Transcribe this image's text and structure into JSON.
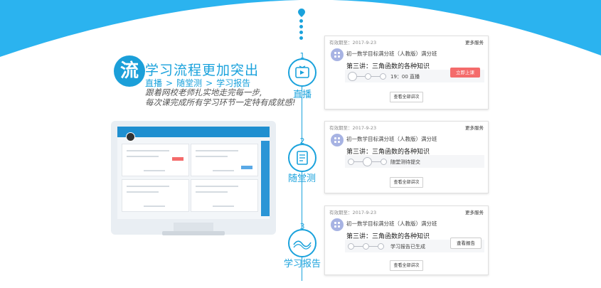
{
  "hero": {
    "badge": "流",
    "title": "学习流程更加突出",
    "steps": [
      "直播",
      "随堂测",
      "学习报告"
    ],
    "separator": ">",
    "line1": "跟着网校老师扎实地走完每一步,",
    "line2": "每次课完成所有学习环节一定特有成就感!"
  },
  "timeline": {
    "steps": [
      {
        "num": "1",
        "label": "直播",
        "icon": "tv-icon"
      },
      {
        "num": "2",
        "label": "随堂测",
        "icon": "quiz-sheet-icon"
      },
      {
        "num": "3",
        "label": "学习报告",
        "icon": "report-wave-icon"
      }
    ]
  },
  "cards": [
    {
      "validity": "有效期至：2017-9-23",
      "more": "更多服务",
      "class_name": "初一数学目标满分班（人教版）满分班",
      "lesson": "第三讲：三角函数的各种知识",
      "status": "19：00 直播",
      "action": "立即上课",
      "all": "查看全部讲次"
    },
    {
      "validity": "有效期至：2017-9-23",
      "more": "更多服务",
      "class_name": "初一数学目标满分班（人教版）满分班",
      "lesson": "第三讲：三角函数的各种知识",
      "status": "随堂测待提交",
      "all": "查看全部讲次"
    },
    {
      "validity": "有效期至：2017-9-23",
      "more": "更多服务",
      "class_name": "初一数学目标满分班（人教版）满分班",
      "lesson": "第三讲：三角函数的各种知识",
      "status": "学习报告已生成",
      "action": "查看报告",
      "all": "查看全部讲次"
    }
  ],
  "colors": {
    "accent": "#1aa2dc",
    "danger": "#f46b6b",
    "icon_bg": "#a7b3e3"
  }
}
